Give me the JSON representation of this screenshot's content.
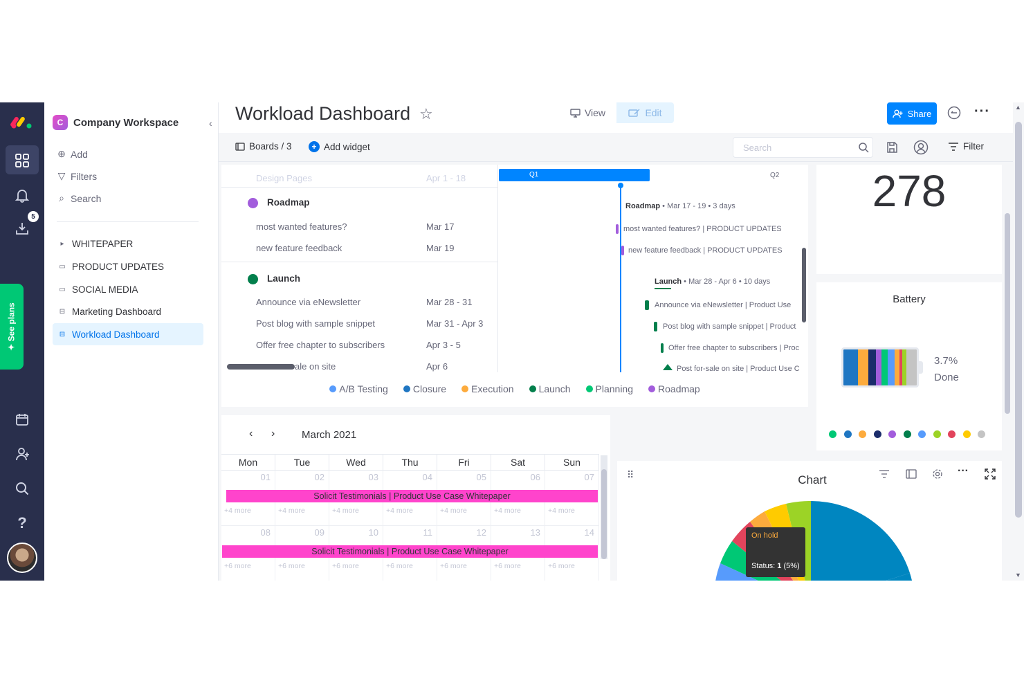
{
  "colors": {
    "rail_bg": "#292f4c",
    "accent": "#0085ff",
    "see_plans": "#00c875",
    "event_pink": "#ff44cc"
  },
  "rail": {
    "items": [
      "monday-logo-icon",
      "boards-icon",
      "bell-icon",
      "inbox-download-icon",
      "see-plans-icon",
      "calendar-icon",
      "invite-person-icon",
      "search-icon",
      "help-icon",
      "avatar"
    ],
    "notification_count": "5",
    "see_plans_label": "See plans"
  },
  "workspace": {
    "logo_letter": "C",
    "name": "Company Workspace",
    "actions": [
      {
        "label": "Add",
        "icon": "plus-circle-icon"
      },
      {
        "label": "Filters",
        "icon": "filter-icon"
      },
      {
        "label": "Search",
        "icon": "search-icon"
      }
    ],
    "items": [
      {
        "label": "WHITEPAPER",
        "icon": "caret-right-icon",
        "active": false
      },
      {
        "label": "PRODUCT UPDATES",
        "icon": "board-icon",
        "active": false
      },
      {
        "label": "SOCIAL MEDIA",
        "icon": "board-icon",
        "active": false
      },
      {
        "label": "Marketing Dashboard",
        "icon": "dashboard-icon",
        "active": false
      },
      {
        "label": "Workload Dashboard",
        "icon": "dashboard-icon",
        "active": true
      }
    ]
  },
  "header": {
    "title": "Workload Dashboard",
    "view_label": "View",
    "edit_label": "Edit",
    "share_label": "Share"
  },
  "toolbar": {
    "boards_label": "Boards / 3",
    "add_widget_label": "Add widget",
    "search_placeholder": "Search",
    "filter_label": "Filter"
  },
  "gantt": {
    "quarters": [
      "Q1",
      "Q2"
    ],
    "faded_row": {
      "name": "Design Pages",
      "date": "Apr 1 - 18"
    },
    "groups": [
      {
        "name": "Roadmap",
        "color": "#a25ddc",
        "summary_name": "Roadmap",
        "summary_dates": " • Mar 17 - 19 • 3 days",
        "rows": [
          {
            "name": "most wanted features?",
            "date": "Mar 17",
            "chart_label": "most wanted features? | PRODUCT UPDATES"
          },
          {
            "name": "new feature feedback",
            "date": "Mar 19",
            "chart_label": "new feature feedback | PRODUCT UPDATES"
          }
        ]
      },
      {
        "name": "Launch",
        "color": "#037f4c",
        "summary_name": "Launch",
        "summary_dates": " • Mar 28 - Apr 6 • 10 days",
        "rows": [
          {
            "name": "Announce via eNewsletter",
            "date": "Mar 28 - 31",
            "chart_label": "Announce via eNewsletter | Product Use"
          },
          {
            "name": "Post blog with sample snippet",
            "date": "Mar 31 - Apr 3",
            "chart_label": "Post blog with sample snippet | Product"
          },
          {
            "name": "Offer free chapter to subscribers",
            "date": "Apr 3 - 5",
            "chart_label": "Offer free chapter to subscribers | Proc"
          },
          {
            "name": "ale on site",
            "date": "Apr 6",
            "chart_label": "Post for-sale on site | Product Use C"
          }
        ]
      }
    ],
    "legend": [
      {
        "label": "A/B Testing",
        "color": "#579bfc"
      },
      {
        "label": "Closure",
        "color": "#1f76c2"
      },
      {
        "label": "Execution",
        "color": "#fdab3d"
      },
      {
        "label": "Launch",
        "color": "#037f4c"
      },
      {
        "label": "Planning",
        "color": "#00c875"
      },
      {
        "label": "Roadmap",
        "color": "#a25ddc"
      }
    ]
  },
  "number_widget": {
    "value": "278"
  },
  "battery": {
    "title": "Battery",
    "percent_label": "3.7%",
    "done_label": "Done",
    "segments": [
      {
        "color": "#1f76c2",
        "share": 0.2
      },
      {
        "color": "#fdab3d",
        "share": 0.14
      },
      {
        "color": "#1b2d6b",
        "share": 0.1
      },
      {
        "color": "#a25ddc",
        "share": 0.08
      },
      {
        "color": "#00c875",
        "share": 0.08
      },
      {
        "color": "#579bfc",
        "share": 0.1
      },
      {
        "color": "#fdab3d",
        "share": 0.06
      },
      {
        "color": "#e2445c",
        "share": 0.04
      },
      {
        "color": "#9cd326",
        "share": 0.06
      },
      {
        "color": "#c4c4c4",
        "share": 0.14
      }
    ],
    "dots": [
      "#00c875",
      "#1f76c2",
      "#fdab3d",
      "#1b2d6b",
      "#a25ddc",
      "#037f4c",
      "#579bfc",
      "#9cd326",
      "#e2445c",
      "#ffcb00",
      "#c4c4c4"
    ]
  },
  "calendar": {
    "month": "March 2021",
    "weekdays": [
      "Mon",
      "Tue",
      "Wed",
      "Thu",
      "Fri",
      "Sat",
      "Sun"
    ],
    "weeks": [
      {
        "days": [
          "01",
          "02",
          "03",
          "04",
          "05",
          "06",
          "07"
        ],
        "more": "+4 more",
        "event": "Solicit Testimonials | Product Use Case Whitepaper"
      },
      {
        "days": [
          "08",
          "09",
          "10",
          "11",
          "12",
          "13",
          "14"
        ],
        "more": "+6 more",
        "event": "Solicit Testimonials | Product Use Case Whitepaper"
      }
    ]
  },
  "chart": {
    "title": "Chart",
    "tooltip_status": "On hold",
    "tooltip_label": "Status: ",
    "tooltip_value": "1",
    "tooltip_pct": " (5%)"
  }
}
